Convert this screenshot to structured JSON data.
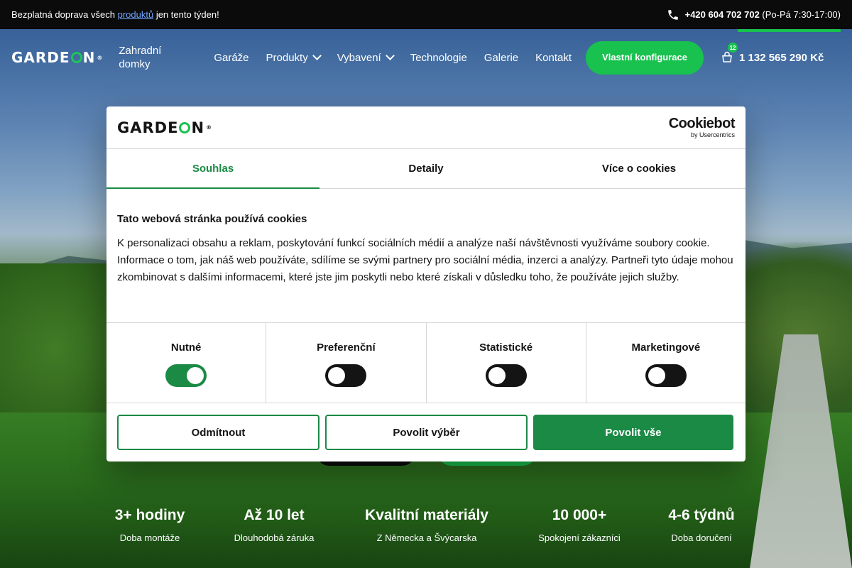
{
  "topbar": {
    "promo_before": "Bezplatná doprava všech ",
    "promo_link": "produktů",
    "promo_after": " jen tento týden!",
    "phone": "+420 604 702 702",
    "hours": "(Po-Pá 7:30-17:00)"
  },
  "header": {
    "logo": "GARDEON",
    "subtitle": "Zahradní domky",
    "nav": [
      {
        "label": "Garáže"
      },
      {
        "label": "Produkty"
      },
      {
        "label": "Vybavení"
      },
      {
        "label": "Technologie"
      },
      {
        "label": "Galerie"
      },
      {
        "label": "Kontakt"
      }
    ],
    "cta": "Vlastní konfigurace",
    "cart_count": "12",
    "cart_total": "1 132 565 290 Kč"
  },
  "dialog": {
    "logo": "GARDEON",
    "provider": "Cookiebot",
    "provider_sub": "by Usercentrics",
    "tabs": [
      {
        "label": "Souhlas",
        "active": true
      },
      {
        "label": "Detaily",
        "active": false
      },
      {
        "label": "Více o cookies",
        "active": false
      }
    ],
    "heading": "Tato webová stránka používá cookies",
    "text": "K personalizaci obsahu a reklam, poskytování funkcí sociálních médií a analýze naší návštěvnosti využíváme soubory cookie. Informace o tom, jak náš web používáte, sdílíme se svými partnery pro sociální média, inzerci a analýzy. Partneři tyto údaje mohou zkombinovat s dalšími informacemi, které jste jim poskytli nebo které získali v důsledku toho, že používáte jejich služby.",
    "toggles": [
      {
        "label": "Nutné",
        "on": true
      },
      {
        "label": "Preferenční",
        "on": false
      },
      {
        "label": "Statistické",
        "on": false
      },
      {
        "label": "Marketingové",
        "on": false
      }
    ],
    "buttons": {
      "reject": "Odmítnout",
      "allow_selection": "Povolit výběr",
      "allow_all": "Povolit vše"
    }
  },
  "stats": [
    {
      "value": "3+ hodiny",
      "label": "Doba montáže"
    },
    {
      "value": "Až 10 let",
      "label": "Dlouhodobá záruka"
    },
    {
      "value": "Kvalitní materiály",
      "label": "Z Německa a Švýcarska"
    },
    {
      "value": "10 000+",
      "label": "Spokojení zákazníci"
    },
    {
      "value": "4-6 týdnů",
      "label": "Doba doručení"
    }
  ],
  "colors": {
    "brand_green": "#19c14f",
    "dialog_green": "#1a8a45",
    "topbar_bg": "#0b0b0b"
  }
}
